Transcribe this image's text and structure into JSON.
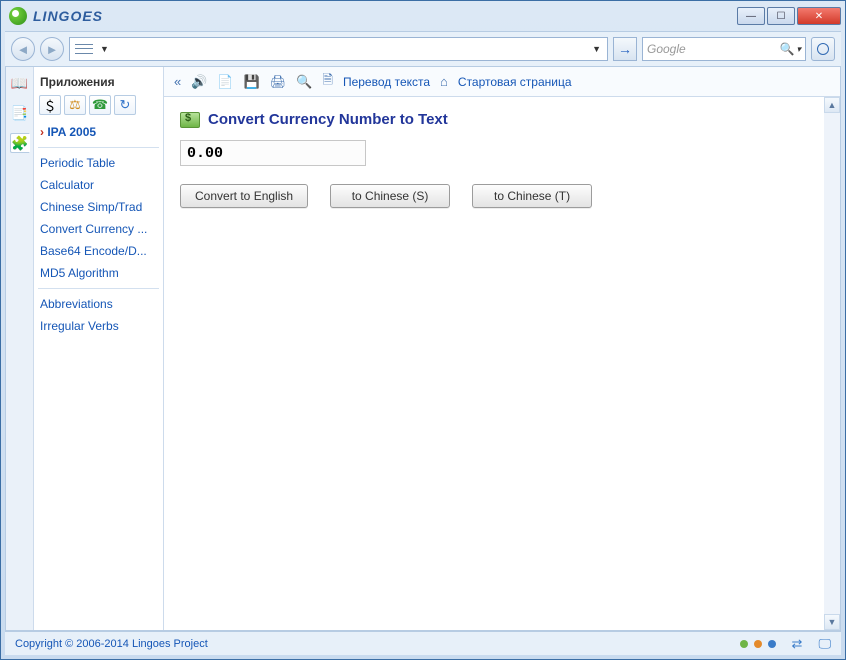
{
  "window": {
    "title": "LINGOES"
  },
  "toolbar": {
    "engine_placeholder": "Google"
  },
  "linkbar": {
    "translate": "Перевод текста",
    "home": "Стартовая страница"
  },
  "sidebar": {
    "header": "Приложения",
    "featured": "IPA 2005",
    "items": [
      "Periodic Table",
      "Calculator",
      "Chinese Simp/Trad",
      "Convert Currency ...",
      "Base64 Encode/D...",
      "MD5 Algorithm"
    ],
    "items2": [
      "Abbreviations",
      "Irregular Verbs"
    ]
  },
  "page": {
    "title": "Convert Currency Number to Text",
    "value": "0.00",
    "btn_en": "Convert to English",
    "btn_cs": "to Chinese (S)",
    "btn_ct": "to Chinese (T)"
  },
  "status": {
    "copyright": "Copyright © 2006-2014 Lingoes Project"
  }
}
